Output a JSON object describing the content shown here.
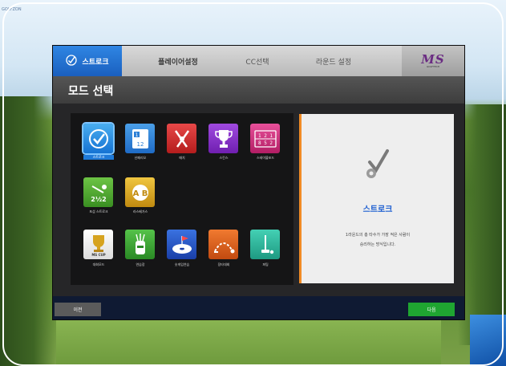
{
  "window_tag": "GOLFZON",
  "tabs": [
    {
      "label": "스트로크",
      "icon": "stroke-check-icon",
      "active": true
    },
    {
      "label": "플레이어설정",
      "active": false
    },
    {
      "label": "CC선택",
      "active": false
    },
    {
      "label": "라운드 설정",
      "active": false
    }
  ],
  "brand": {
    "logo_text": "MS",
    "sub": "GOLFTECH"
  },
  "page_title": "모드 선택",
  "modes": [
    {
      "label": "스트로크",
      "icon": "stroke-check-icon",
      "color": "#1e8fe6",
      "selected": true
    },
    {
      "label": "신페리오",
      "icon": "scorecard-icon",
      "color": "#2c7fd6"
    },
    {
      "label": "매치",
      "icon": "crossed-clubs-icon",
      "color": "#d52a2a"
    },
    {
      "label": "스킨스",
      "icon": "trophy-icon",
      "color": "#8a2fc9"
    },
    {
      "label": "스테이블포드",
      "icon": "scoreboard-icon",
      "color": "#d6307a"
    },
    {
      "label": "포섬 스트로크",
      "icon": "pair-score-icon",
      "color": "#4ca52a"
    },
    {
      "label": "라스베가스",
      "icon": "dice-ball-icon",
      "color": "#d6a320"
    },
    {
      "label": "대회모드",
      "icon": "cup-badge-icon",
      "color": "#f2f2f2"
    },
    {
      "label": "연습장",
      "icon": "golf-bag-icon",
      "color": "#3ca83a"
    },
    {
      "label": "숏게임연습",
      "icon": "putting-green-icon",
      "color": "#2459c7"
    },
    {
      "label": "장타대회",
      "icon": "long-drive-icon",
      "color": "#e0651c"
    },
    {
      "label": "퍼팅",
      "icon": "putter-icon",
      "color": "#2fb8a0"
    }
  ],
  "detail": {
    "icon": "stroke-check-icon",
    "name": "스트로크",
    "description_line1": "1라운드의 총 타수가 가장 적은 사람이",
    "description_line2": "승리하는 방식입니다."
  },
  "footer": {
    "prev_label": "이전",
    "next_label": "다음"
  }
}
